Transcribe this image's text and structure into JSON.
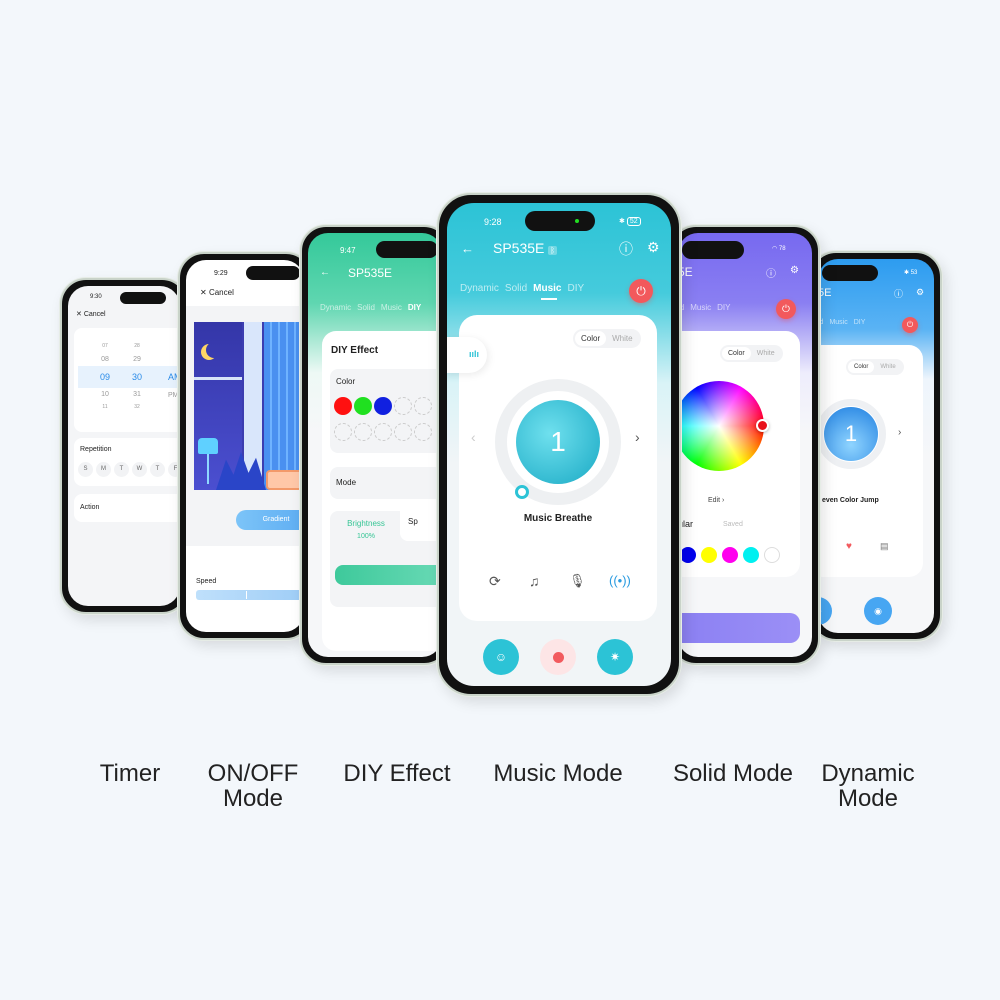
{
  "labels": {
    "timer": "Timer",
    "onoff_1": "ON/OFF",
    "onoff_2": "Mode",
    "diy": "DIY Effect",
    "music": "Music Mode",
    "solid": "Solid Mode",
    "dynamic_1": "Dynamic",
    "dynamic_2": "Mode"
  },
  "device_name": "SP535E",
  "tabs": [
    "Dynamic",
    "Solid",
    "Music",
    "DIY"
  ],
  "timer_screen": {
    "time": "9:30",
    "cancel": "Cancel",
    "hours": [
      "07",
      "08",
      "09",
      "10",
      "11"
    ],
    "minutes": [
      "28",
      "29",
      "30",
      "31",
      "32"
    ],
    "ampm": [
      "AM",
      "PM"
    ],
    "repetition": "Repetition",
    "days": [
      "S",
      "M",
      "T",
      "W",
      "T",
      "F"
    ],
    "action": "Action"
  },
  "onoff_screen": {
    "time": "9:29",
    "cancel": "Cancel",
    "gradient": "Gradient",
    "speed": "Speed"
  },
  "diy_screen": {
    "time": "9:47",
    "title": "DIY Effect",
    "color": "Color",
    "mode": "Mode",
    "brightness": "Brightness",
    "brightness_value": "100%",
    "speed_tab": "Sp",
    "colors": [
      "#ff1010",
      "#20e020",
      "#1020e0"
    ]
  },
  "music_screen": {
    "time": "9:28",
    "battery": "52",
    "color": "Color",
    "white": "White",
    "effect_number": "1",
    "effect": "Music Breathe",
    "accent": "#2cc3d6"
  },
  "solid_screen": {
    "battery": "78",
    "header": "5E",
    "tabs": [
      "id",
      "Music",
      "DIY"
    ],
    "color": "Color",
    "white": "White",
    "edit": "Edit ›",
    "regular": "egular",
    "saved": "Saved",
    "swatches": [
      "#0000ee",
      "#ffff00",
      "#ff00ee",
      "#00f0f0",
      "#ffffff"
    ],
    "accent": "#7b6cf0"
  },
  "dynamic_screen": {
    "battery": "53",
    "header": "5E",
    "tabs": [
      "id",
      "Music",
      "DIY"
    ],
    "color": "Color",
    "white": "White",
    "effect_number": "1",
    "effect": "even Color Jump",
    "accent": "#2d9cf0"
  }
}
